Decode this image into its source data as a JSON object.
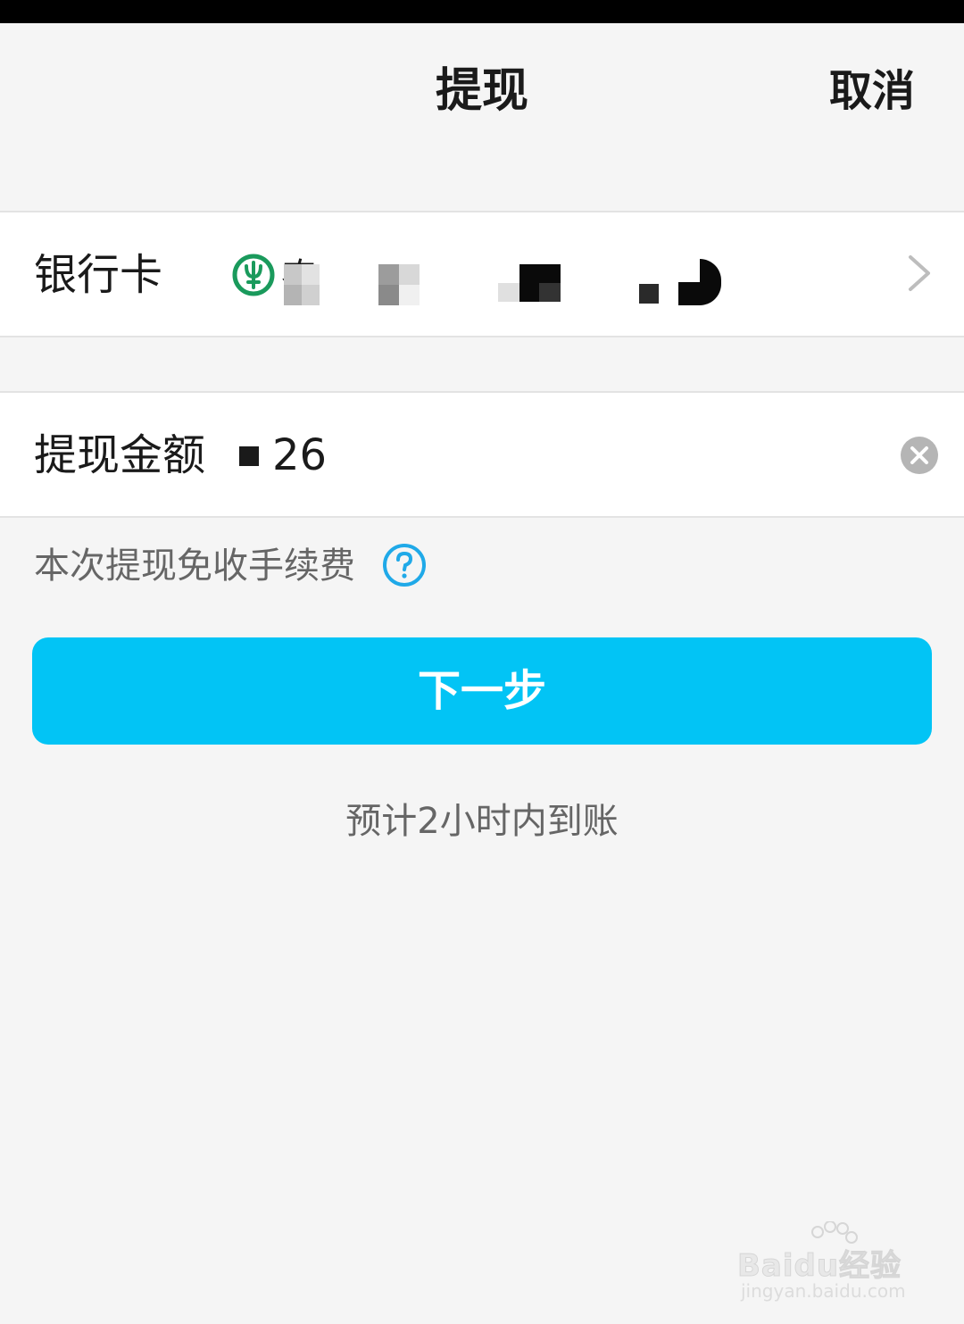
{
  "nav": {
    "title": "提现",
    "cancel_label": "取消"
  },
  "bank_row": {
    "label": "银行卡",
    "bank_name_visible": "农",
    "bank_logo_color": "#1a9a5c",
    "chevron_icon": "chevron-right-icon"
  },
  "amount_row": {
    "label": "提现金额",
    "value_visible": "26",
    "clear_icon": "clear-circle-icon"
  },
  "fee_note": "本次提现免收手续费",
  "help_icon": "question-circle-icon",
  "next_button_label": "下一步",
  "eta_note": "预计2小时内到账",
  "watermark": {
    "main": "Baidu经验",
    "sub": "jingyan.baidu.com"
  },
  "colors": {
    "accent": "#02c4f5",
    "background": "#f5f5f5",
    "text_primary": "#1a1a1a",
    "text_secondary": "#666666"
  }
}
